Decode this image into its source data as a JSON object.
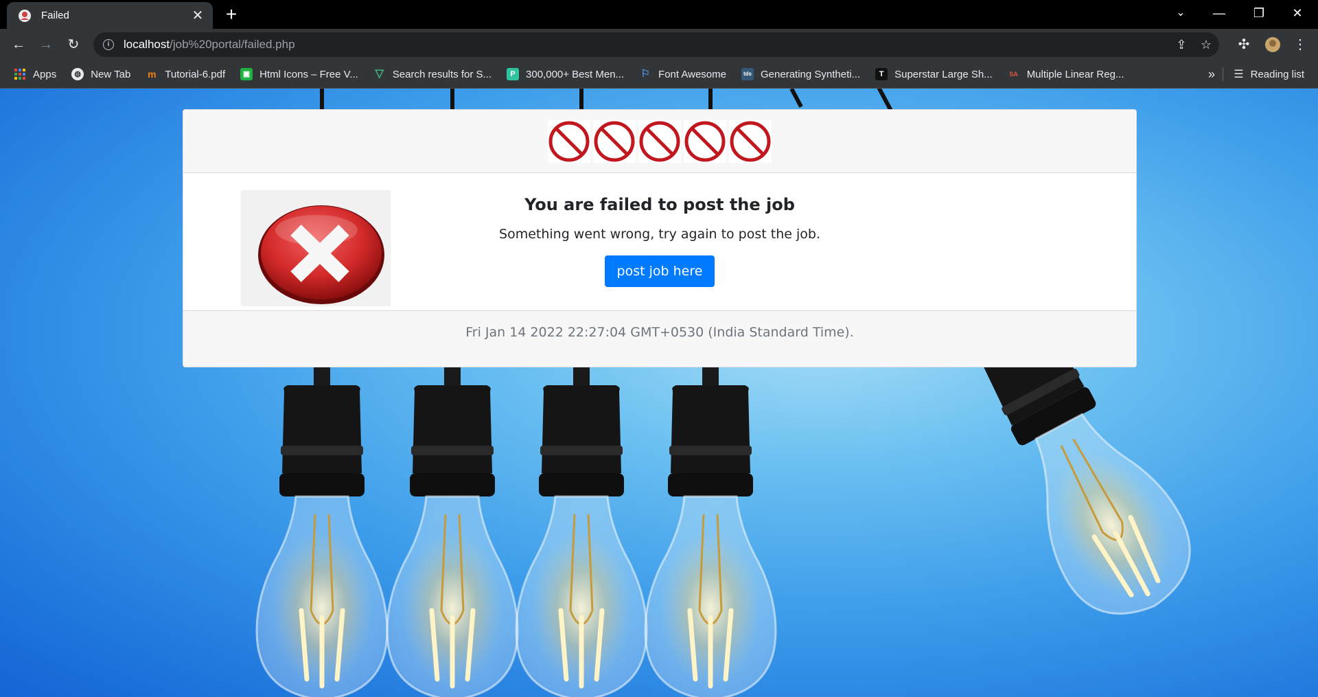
{
  "browser": {
    "tab_title": "Failed",
    "tab_close": "✕",
    "new_tab": "+",
    "url_host": "localhost",
    "url_path": "/job%20portal/failed.php",
    "window_controls": {
      "minimize": "—",
      "restore": "❐",
      "close": "✕",
      "tab_search": "⌄"
    }
  },
  "bookmarks": {
    "items": [
      {
        "label": "Apps",
        "icon": "apps-grid-icon"
      },
      {
        "label": "New Tab",
        "icon": "globe-icon"
      },
      {
        "label": "Tutorial-6.pdf",
        "icon": "moodle-icon"
      },
      {
        "label": "Html Icons – Free V...",
        "icon": "html-icons-icon"
      },
      {
        "label": "Search results for S...",
        "icon": "vue-icon"
      },
      {
        "label": "300,000+ Best Men...",
        "icon": "p-icon"
      },
      {
        "label": "Font Awesome",
        "icon": "flag-icon"
      },
      {
        "label": "Generating Syntheti...",
        "icon": "tds-icon"
      },
      {
        "label": "Superstar Large Sh...",
        "icon": "t-icon"
      },
      {
        "label": "Multiple Linear Reg...",
        "icon": "sa-icon"
      }
    ],
    "more": "»",
    "reading_list": "Reading list"
  },
  "page": {
    "title": "You are failed to post the job",
    "message": "Something went wrong, try again to post the job.",
    "button_label": "post job here",
    "timestamp": "Fri Jan 14 2022 22:27:04 GMT+0530 (India Standard Time)."
  },
  "colors": {
    "primary": "#007bff",
    "no_sign_red": "#c0181e",
    "error_red": "#d42a2a"
  }
}
